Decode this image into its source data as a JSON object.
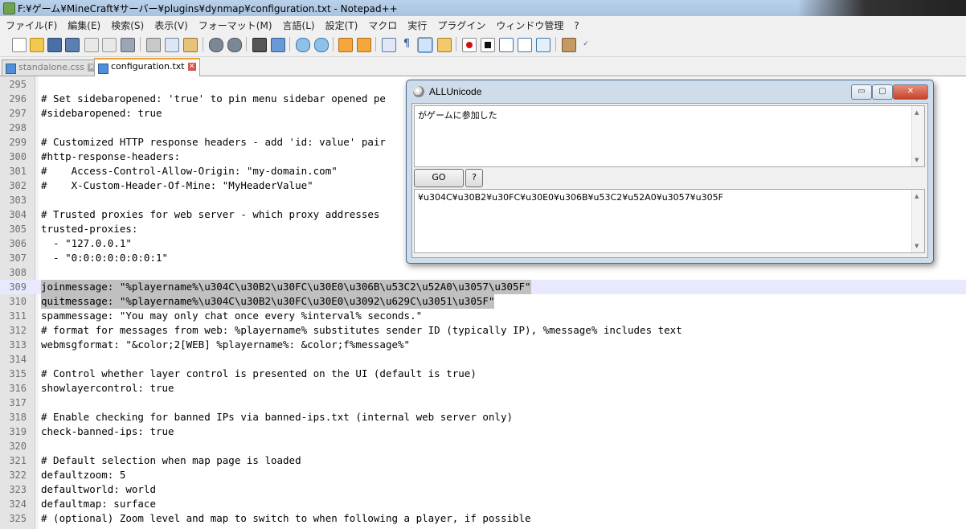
{
  "window": {
    "title": "F:¥ゲーム¥MineCraft¥サーバー¥plugins¥dynmap¥configuration.txt - Notepad++"
  },
  "menu": [
    "ファイル(F)",
    "編集(E)",
    "検索(S)",
    "表示(V)",
    "フォーマット(M)",
    "言語(L)",
    "設定(T)",
    "マクロ",
    "実行",
    "プラグイン",
    "ウィンドウ管理",
    "?"
  ],
  "toolbar_icons": [
    "new-file-icon",
    "open-file-icon",
    "save-icon",
    "save-all-icon",
    "close-icon",
    "close-all-icon",
    "print-icon",
    "cut-icon",
    "copy-icon",
    "paste-icon",
    "undo-icon",
    "redo-icon",
    "find-icon",
    "replace-icon",
    "zoom-in-icon",
    "zoom-out-icon",
    "sync-vertical-icon",
    "sync-horizontal-icon",
    "word-wrap-icon",
    "show-all-chars-icon",
    "indent-guide-icon",
    "doc-map-icon",
    "record-macro-icon",
    "stop-macro-icon",
    "play-macro-icon",
    "run-macro-multiple-icon",
    "save-macro-icon",
    "spell-check-icon",
    "abc-check-icon"
  ],
  "tabs": [
    {
      "label": "standalone.css",
      "active": false
    },
    {
      "label": "configuration.txt",
      "active": true
    }
  ],
  "editor": {
    "lines": [
      {
        "n": "295",
        "text": ""
      },
      {
        "n": "296",
        "text": "# Set sidebaropened: 'true' to pin menu sidebar opened pe"
      },
      {
        "n": "297",
        "text": "#sidebaropened: true"
      },
      {
        "n": "298",
        "text": ""
      },
      {
        "n": "299",
        "text": "# Customized HTTP response headers - add 'id: value' pair"
      },
      {
        "n": "300",
        "text": "#http-response-headers:"
      },
      {
        "n": "301",
        "text": "#    Access-Control-Allow-Origin: \"my-domain.com\""
      },
      {
        "n": "302",
        "text": "#    X-Custom-Header-Of-Mine: \"MyHeaderValue\""
      },
      {
        "n": "303",
        "text": ""
      },
      {
        "n": "304",
        "text": "# Trusted proxies for web server - which proxy addresses"
      },
      {
        "n": "305",
        "text": "trusted-proxies:"
      },
      {
        "n": "306",
        "text": "  - \"127.0.0.1\""
      },
      {
        "n": "307",
        "text": "  - \"0:0:0:0:0:0:0:1\""
      },
      {
        "n": "308",
        "text": ""
      },
      {
        "n": "309",
        "text": "joinmessage: \"%playername%\\u304C\\u30B2\\u30FC\\u30E0\\u306B\\u53C2\\u52A0\\u3057\\u305F\""
      },
      {
        "n": "310",
        "text": "quitmessage: \"%playername%\\u304C\\u30B2\\u30FC\\u30E0\\u3092\\u629C\\u3051\\u305F\""
      },
      {
        "n": "311",
        "text": "spammessage: \"You may only chat once every %interval% seconds.\""
      },
      {
        "n": "312",
        "text": "# format for messages from web: %playername% substitutes sender ID (typically IP), %message% includes text"
      },
      {
        "n": "313",
        "text": "webmsgformat: \"&color;2[WEB] %playername%: &color;f%message%\""
      },
      {
        "n": "314",
        "text": ""
      },
      {
        "n": "315",
        "text": "# Control whether layer control is presented on the UI (default is true)"
      },
      {
        "n": "316",
        "text": "showlayercontrol: true"
      },
      {
        "n": "317",
        "text": ""
      },
      {
        "n": "318",
        "text": "# Enable checking for banned IPs via banned-ips.txt (internal web server only)"
      },
      {
        "n": "319",
        "text": "check-banned-ips: true"
      },
      {
        "n": "320",
        "text": ""
      },
      {
        "n": "321",
        "text": "# Default selection when map page is loaded"
      },
      {
        "n": "322",
        "text": "defaultzoom: 5"
      },
      {
        "n": "323",
        "text": "defaultworld: world"
      },
      {
        "n": "324",
        "text": "defaultmap: surface"
      },
      {
        "n": "325",
        "text": "# (optional) Zoom level and map to switch to when following a player, if possible"
      }
    ]
  },
  "dialog": {
    "title": "ALLUnicode",
    "input_text": "がゲームに参加した",
    "go_label": "GO",
    "help_label": "?",
    "output_text": "¥u304C¥u30B2¥u30FC¥u30E0¥u306B¥u53C2¥u52A0¥u3057¥u305F",
    "minimize_glyph": "▭",
    "maximize_glyph": "▢",
    "close_glyph": "✕"
  },
  "colors": {
    "selection_gray": "#c0c0c0",
    "current_line": "#e8e8ff",
    "active_tab_accent": "#f0a030"
  }
}
